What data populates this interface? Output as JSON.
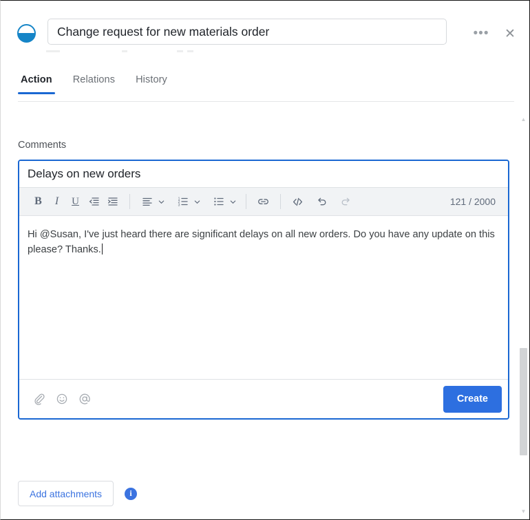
{
  "header": {
    "logo_name": "app-logo",
    "title_value": "Change request for new materials order",
    "more_label": "•••",
    "close_label": "✕"
  },
  "tabs": [
    {
      "label": "Action",
      "active": true
    },
    {
      "label": "Relations",
      "active": false
    },
    {
      "label": "History",
      "active": false
    }
  ],
  "main": {
    "section_label": "Comments"
  },
  "editor": {
    "subject_value": "Delays on new orders",
    "body_text": "Hi @Susan, I've just heard there are significant delays on all new orders. Do you have any update on this please? Thanks.",
    "counter": "121 / 2000",
    "toolbar": [
      {
        "name": "bold-icon",
        "glyph": "B",
        "kind": "text",
        "style": "serif-bold",
        "disabled": false
      },
      {
        "name": "italic-icon",
        "glyph": "I",
        "kind": "text",
        "style": "serif-italic",
        "disabled": false
      },
      {
        "name": "underline-icon",
        "glyph": "U",
        "kind": "text",
        "style": "serif-underline",
        "disabled": false
      },
      {
        "name": "outdent-icon",
        "kind": "svg",
        "disabled": false
      },
      {
        "name": "indent-icon",
        "kind": "svg",
        "disabled": false
      },
      {
        "name": "align-icon",
        "kind": "svg",
        "disabled": false,
        "has_caret": true
      },
      {
        "name": "ordered-list-icon",
        "kind": "svg",
        "disabled": false,
        "has_caret": true
      },
      {
        "name": "bulleted-list-icon",
        "kind": "svg",
        "disabled": false,
        "has_caret": true
      },
      {
        "name": "link-icon",
        "kind": "svg",
        "disabled": false
      },
      {
        "name": "code-icon",
        "kind": "svg",
        "disabled": false
      },
      {
        "name": "undo-icon",
        "kind": "svg",
        "disabled": false
      },
      {
        "name": "redo-icon",
        "kind": "svg",
        "disabled": true
      }
    ],
    "footer_icons": [
      {
        "name": "attach-paperclip-icon"
      },
      {
        "name": "emoji-icon"
      },
      {
        "name": "mention-at-icon"
      }
    ],
    "create_label": "Create"
  },
  "attachments": {
    "button_label": "Add attachments",
    "info_glyph": "i"
  },
  "colors": {
    "accent_blue": "#1967d2",
    "create_blue": "#2d6fe0",
    "link_blue": "#3b73e0",
    "logo_blue": "#1685c7",
    "toolbar_bg": "#f1f3f5",
    "text_dark": "#20242a",
    "text_muted": "#6a6f75"
  },
  "scrollbar": {
    "up_glyph": "▲",
    "down_glyph": "▼"
  }
}
